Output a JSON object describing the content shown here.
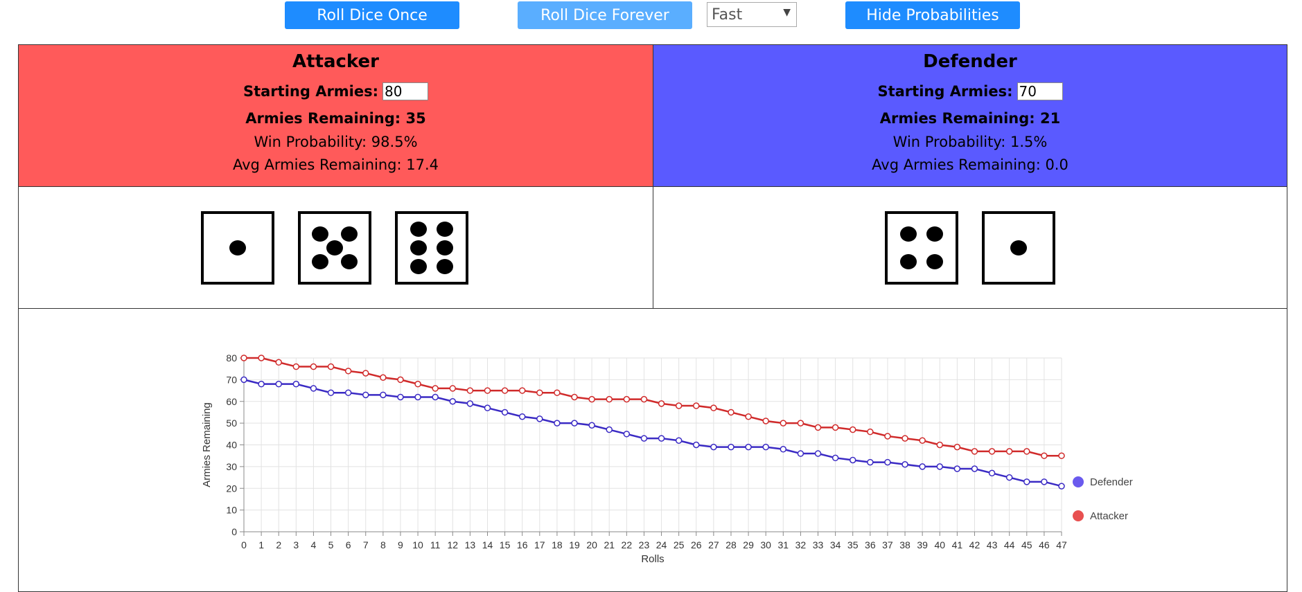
{
  "controls": {
    "roll_once_label": "Roll Dice Once",
    "roll_forever_label": "Roll Dice Forever",
    "speed_value": "Fast",
    "hide_prob_label": "Hide Probabilities"
  },
  "attacker": {
    "title": "Attacker",
    "starting_label": "Starting Armies:",
    "starting_value": "80",
    "remaining_text": "Armies Remaining: 35",
    "win_prob_text": "Win Probability: 98.5%",
    "avg_text": "Avg Armies Remaining: 17.4",
    "color": "#ff5a5a",
    "dice": [
      1,
      5,
      6
    ]
  },
  "defender": {
    "title": "Defender",
    "starting_label": "Starting Armies:",
    "starting_value": "70",
    "remaining_text": "Armies Remaining: 21",
    "win_prob_text": "Win Probability: 1.5%",
    "avg_text": "Avg Armies Remaining: 0.0",
    "color": "#5a5aff",
    "dice": [
      4,
      1
    ]
  },
  "chart_data": {
    "type": "line",
    "xlabel": "Rolls",
    "ylabel": "Armies Remaining",
    "ylim": [
      0,
      80
    ],
    "yticks": [
      0,
      10,
      20,
      30,
      40,
      50,
      60,
      70,
      80
    ],
    "x": [
      0,
      1,
      2,
      3,
      4,
      5,
      6,
      7,
      8,
      9,
      10,
      11,
      12,
      13,
      14,
      15,
      16,
      17,
      18,
      19,
      20,
      21,
      22,
      23,
      24,
      25,
      26,
      27,
      28,
      29,
      30,
      31,
      32,
      33,
      34,
      35,
      36,
      37,
      38,
      39,
      40,
      41,
      42,
      43,
      44,
      45,
      46,
      47
    ],
    "legend_position": "right",
    "grid": true,
    "series": [
      {
        "name": "Defender",
        "color": "#3a2ac4",
        "legend_color": "#6a5aee",
        "values": [
          70,
          68,
          68,
          68,
          66,
          64,
          64,
          63,
          63,
          62,
          62,
          62,
          60,
          59,
          57,
          55,
          53,
          52,
          50,
          50,
          49,
          47,
          45,
          43,
          43,
          42,
          40,
          39,
          39,
          39,
          39,
          38,
          36,
          36,
          34,
          33,
          32,
          32,
          31,
          30,
          30,
          29,
          29,
          27,
          25,
          23,
          23,
          21
        ]
      },
      {
        "name": "Attacker",
        "color": "#d02a2a",
        "legend_color": "#e85050",
        "values": [
          80,
          80,
          78,
          76,
          76,
          76,
          74,
          73,
          71,
          70,
          68,
          66,
          66,
          65,
          65,
          65,
          65,
          64,
          64,
          62,
          61,
          61,
          61,
          61,
          59,
          58,
          58,
          57,
          55,
          53,
          51,
          50,
          50,
          48,
          48,
          47,
          46,
          44,
          43,
          42,
          40,
          39,
          37,
          37,
          37,
          37,
          35,
          35
        ]
      }
    ]
  }
}
